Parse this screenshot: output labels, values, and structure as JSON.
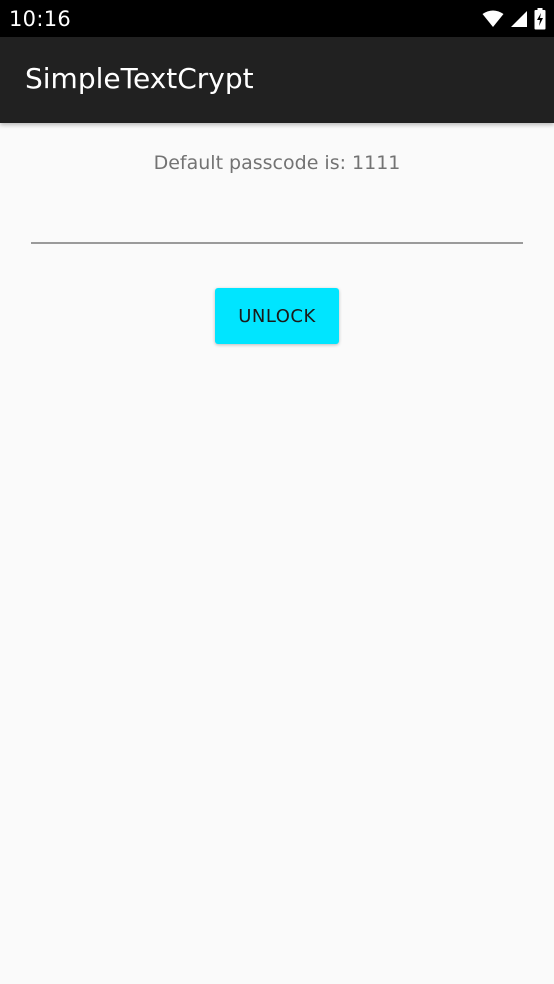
{
  "status_bar": {
    "time": "10:16",
    "icons": [
      "wifi-icon",
      "signal-icon",
      "battery-icon"
    ]
  },
  "app_bar": {
    "title": "SimpleTextCrypt"
  },
  "main": {
    "hint": "Default passcode is: 1111",
    "passcode_value": "",
    "passcode_placeholder": "",
    "unlock_label": "UNLOCK"
  },
  "colors": {
    "status_bar": "#000000",
    "app_bar": "#212121",
    "background": "#fafafa",
    "accent_button": "#00e5ff",
    "hint_text": "#737373"
  }
}
